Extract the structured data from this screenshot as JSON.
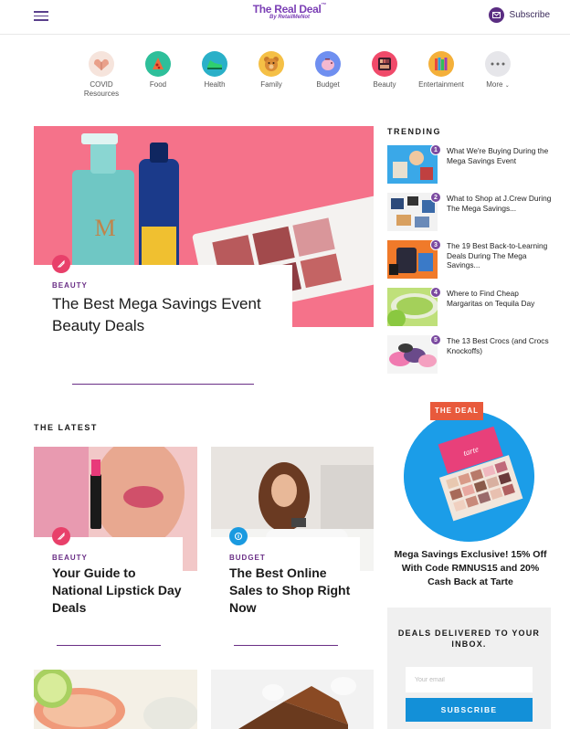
{
  "header": {
    "logo_main": "The Real Deal",
    "logo_by": "By RetailMeNot",
    "subscribe_label": "Subscribe"
  },
  "categories": [
    {
      "label": "COVID Resources",
      "icon": "heart-hands-icon",
      "color": "#f2d0c4"
    },
    {
      "label": "Food",
      "icon": "pizza-icon",
      "color": "#2ebf9a"
    },
    {
      "label": "Health",
      "icon": "sneaker-icon",
      "color": "#2ab0c8"
    },
    {
      "label": "Family",
      "icon": "teddy-bear-icon",
      "color": "#f5c046"
    },
    {
      "label": "Budget",
      "icon": "piggy-bank-icon",
      "color": "#6f8ff0"
    },
    {
      "label": "Beauty",
      "icon": "eyeshadow-palette-icon",
      "color": "#f04a6a"
    },
    {
      "label": "Entertainment",
      "icon": "books-icon",
      "color": "#f4b03a"
    },
    {
      "label": "More",
      "icon": "more-dots-icon",
      "color": "#e6e6e6"
    }
  ],
  "hero": {
    "category": "BEAUTY",
    "title": "The Best Mega Savings Event Beauty Deals"
  },
  "trending": {
    "heading": "TRENDING",
    "items": [
      {
        "num": "1",
        "title": "What We're Buying During the Mega Savings Event"
      },
      {
        "num": "2",
        "title": "What to Shop at J.Crew During The Mega Savings..."
      },
      {
        "num": "3",
        "title": "The 19 Best Back-to-Learning Deals During The Mega Savings..."
      },
      {
        "num": "4",
        "title": "Where to Find Cheap Margaritas on Tequila Day"
      },
      {
        "num": "5",
        "title": "The 13 Best Crocs (and Crocs Knockoffs)"
      }
    ]
  },
  "latest": {
    "heading": "THE LATEST",
    "cards": [
      {
        "category": "BEAUTY",
        "title": "Your Guide to National Lipstick Day Deals"
      },
      {
        "category": "BUDGET",
        "title": "The Best Online Sales to Shop Right Now"
      }
    ]
  },
  "deal": {
    "tag": "THE DEAL",
    "text": "Mega Savings Exclusive! 15% Off With Code RMNUS15 and 20% Cash Back at Tarte",
    "palette_label": "tarte"
  },
  "newsletter": {
    "heading": "DEALS DELIVERED TO YOUR INBOX.",
    "placeholder": "Your email",
    "button": "SUBSCRIBE"
  },
  "colors": {
    "brand_purple": "#6a2f86",
    "hero_pink": "#f5728a",
    "deal_orange": "#e85a3c",
    "deal_blue": "#1b9de8",
    "subscribe_blue": "#1390d8"
  }
}
